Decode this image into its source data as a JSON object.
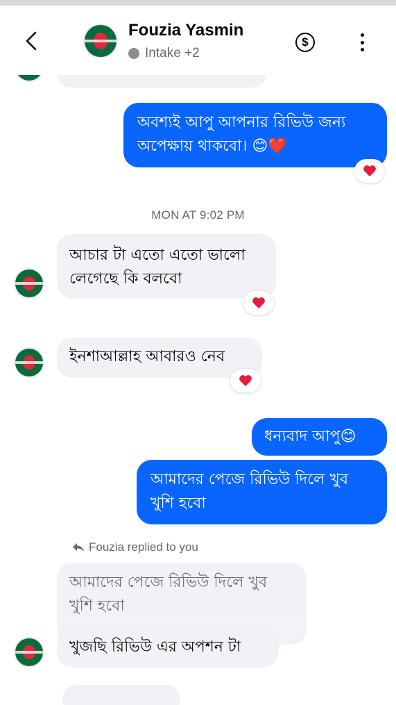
{
  "header": {
    "contact_name": "Fouzia Yasmin",
    "contact_subtitle": "Intake +2",
    "icons": [
      "back-arrow-icon",
      "dollar-icon",
      "more-vertical-icon"
    ]
  },
  "conversation": {
    "messages": [
      {
        "id": "m1",
        "direction": "outgoing",
        "text": "অবশ্যই আপু আপনার রিভিউ জন্য\nঅপেক্ষায় থাকবো। 😊❤️",
        "reaction": "❤️"
      },
      {
        "id": "ts1",
        "type": "timestamp",
        "text": "MON AT 9:02 PM"
      },
      {
        "id": "m2",
        "direction": "incoming",
        "text": "আচার টা এতো এতো ভালো\nলেগেছে কি বলবো",
        "reaction": "❤️"
      },
      {
        "id": "m3",
        "direction": "incoming",
        "text": "ইনশাআল্লাহ আবারও নেব",
        "reaction": "❤️"
      },
      {
        "id": "m4",
        "direction": "outgoing",
        "text": "ধন্যবাদ আপু😊"
      },
      {
        "id": "m5",
        "direction": "outgoing",
        "text": "আমাদের পেজে রিভিউ দিলে খুব\nখুশি হবো"
      },
      {
        "id": "m6",
        "direction": "incoming",
        "reply_label": "Fouzia replied to you",
        "quoted_text": "আমাদের পেজে রিভিউ দিলে খুব\nখুশি হবো",
        "text": "খুজছি রিভিউ এর অপশন টা"
      }
    ]
  },
  "colors": {
    "outgoing_bubble": "#0866ff",
    "incoming_bubble": "#f0f2f5",
    "reaction_heart": "#e41e3f"
  }
}
